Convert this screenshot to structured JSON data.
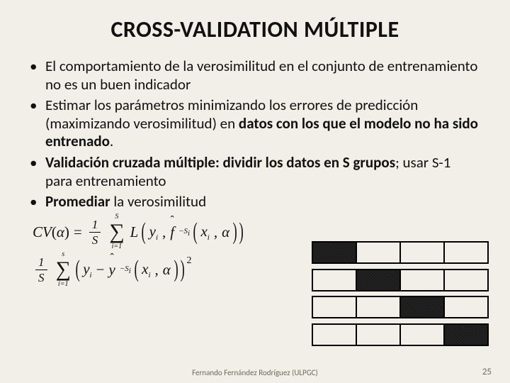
{
  "title": "CROSS-VALIDATION MÚLTIPLE",
  "bullets": {
    "b1": "El comportamiento de la verosimilitud en el conjunto de entrenamiento no es un buen indicador",
    "b2a": "Estimar los parámetros minimizando los errores de predicción  (maximizando verosimilitud) en ",
    "b2b": "datos con los que el modelo no ha sido entrenado",
    "b2c": ".",
    "b3a": "Validación cruzada múltiple: dividir los datos en S grupos",
    "b3b": "; usar S-1 para entrenamiento",
    "b4a": "Promediar",
    "b4b": " la verosimilitud"
  },
  "formula1": {
    "lhs": "CV",
    "alpha": "α",
    "eq": "=",
    "one": "1",
    "S": "S",
    "sum_top": "S",
    "sum_bot": "i=1",
    "L": "L",
    "yi": "y",
    "i": "i",
    "fhat": "f",
    "msi": "−S",
    "xi": "x",
    "comma": ",",
    "close": ""
  },
  "formula2": {
    "one": "1",
    "S": "S",
    "sum_top": "s",
    "sum_bot": "i=1",
    "yi": "y",
    "i": "i",
    "minus": "−",
    "yhat": "y",
    "msi": "−S",
    "xi": "x",
    "alpha": "α",
    "sq": "2"
  },
  "cv": {
    "rows": 4,
    "cols": 4,
    "filled": [
      [
        0,
        0
      ],
      [
        1,
        1
      ],
      [
        2,
        2
      ],
      [
        3,
        3
      ]
    ]
  },
  "footer": "Fernando Fernández Rodríguez (ULPGC)",
  "page": "25"
}
